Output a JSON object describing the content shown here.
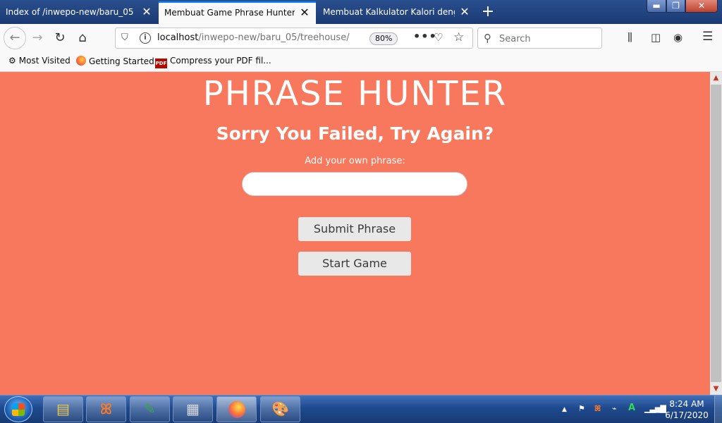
{
  "browser": {
    "tabs": [
      {
        "title": "Index of /inwepo-new/baru_05",
        "active": false
      },
      {
        "title": "Membuat Game Phrase Hunter dengan JavaScript",
        "active": true
      },
      {
        "title": "Membuat Kalkulator Kalori dengan JavaScript",
        "active": false
      }
    ],
    "url_host": "localhost",
    "url_path": "/inwepo-new/baru_05/treehouse/",
    "zoom": "80%",
    "search_placeholder": "Search",
    "bookmarks": [
      {
        "label": "Most Visited",
        "icon": "gear-icon"
      },
      {
        "label": "Getting Started",
        "icon": "firefox-icon"
      },
      {
        "label": "Compress your PDF fil...",
        "icon": "pdf-icon"
      }
    ],
    "pdf_icon_text": "PDF"
  },
  "page": {
    "title": "PHRASE HUNTER",
    "message": "Sorry You Failed, Try Again?",
    "phrase_label": "Add your own phrase:",
    "phrase_value": "",
    "submit_label": "Submit Phrase",
    "start_label": "Start Game",
    "background_color": "#f7785d"
  },
  "taskbar": {
    "clock_time": "8:24 AM",
    "clock_date": "6/17/2020"
  }
}
